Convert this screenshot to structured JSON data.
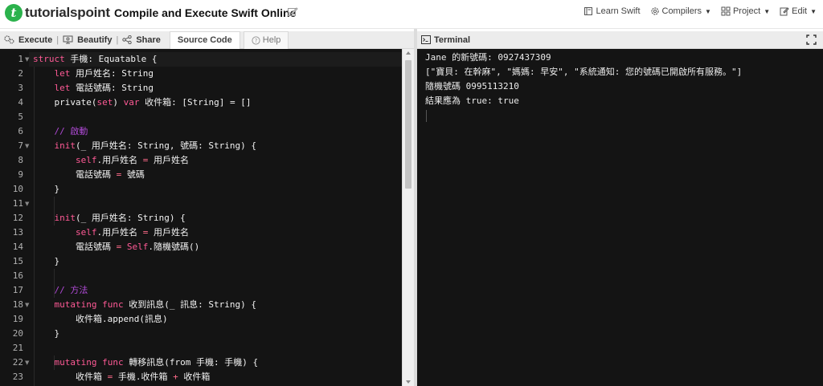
{
  "header": {
    "logo_text": "tutorialspoint",
    "title": "Compile and Execute Swift Online",
    "nav": [
      {
        "label": "Learn Swift",
        "icon": "book-icon"
      },
      {
        "label": "Compilers",
        "icon": "gear-icon",
        "caret": true
      },
      {
        "label": "Project",
        "icon": "grid-icon",
        "caret": true
      },
      {
        "label": "Edit",
        "icon": "edit-icon",
        "caret": true
      }
    ]
  },
  "toolbar": {
    "execute_label": "Execute",
    "beautify_label": "Beautify",
    "share_label": "Share",
    "source_code_tab": "Source Code",
    "help_tab": "Help",
    "separator": "|"
  },
  "editor": {
    "line_numbers": [
      "1",
      "2",
      "3",
      "4",
      "5",
      "6",
      "7",
      "8",
      "9",
      "10",
      "11",
      "12",
      "13",
      "14",
      "15",
      "16",
      "17",
      "18",
      "19",
      "20",
      "21",
      "22",
      "23"
    ],
    "fold_lines": [
      1,
      7,
      11,
      18,
      22
    ]
  },
  "terminal": {
    "title": "Terminal",
    "lines": [
      "Jane 的新號碼: 0927437309",
      "[\"寶貝: 在幹麻\", \"媽媽: 早安\", \"系統通知: 您的號碼已開啟所有服務。\"]",
      "隨機號碼 0995113210",
      "結果應為 true: true"
    ]
  },
  "colors": {
    "editor_bg": "#141414",
    "keyword": "#ff5a96",
    "comment": "#b04ad6",
    "logo_green": "#2bb24c"
  }
}
